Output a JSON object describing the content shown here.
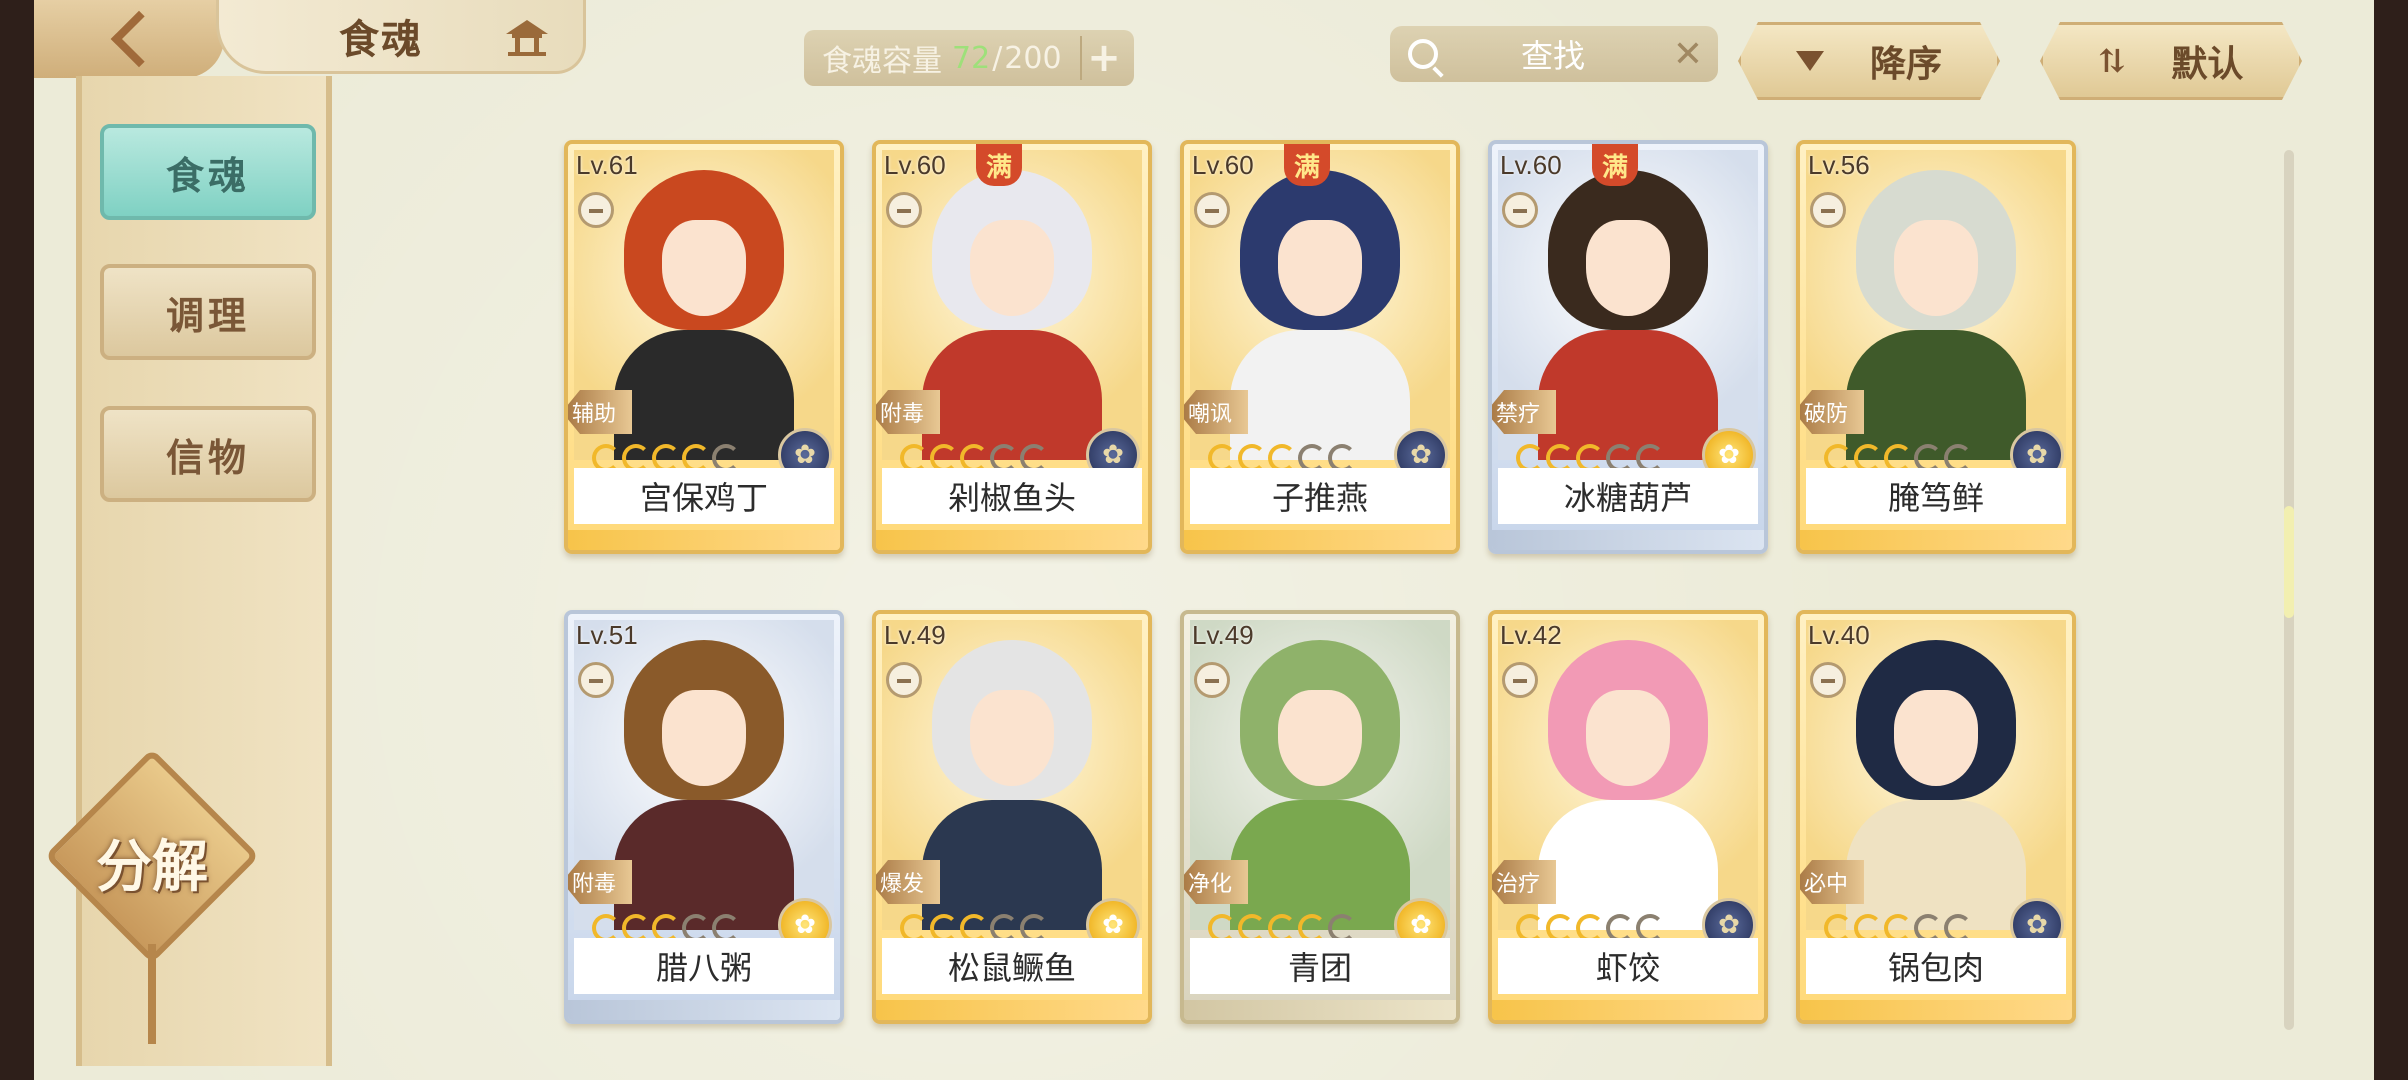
{
  "header": {
    "title": "食魂",
    "capacity_label": "食魂容量",
    "capacity_current": "72",
    "capacity_max": "200",
    "search_placeholder": "查找",
    "sort_label": "降序",
    "default_label": "默认"
  },
  "sidebar": {
    "items": [
      {
        "label": "食魂",
        "active": true
      },
      {
        "label": "调理",
        "active": false
      },
      {
        "label": "信物",
        "active": false
      }
    ],
    "decompose_label": "分解"
  },
  "cards": [
    {
      "level": "Lv.61",
      "name": "宫保鸡丁",
      "role": "辅助",
      "stars_filled": 4,
      "stars_total": 5,
      "maxed": false,
      "element_icon": "night-flower-icon",
      "frame": "gold"
    },
    {
      "level": "Lv.60",
      "name": "剁椒鱼头",
      "role": "附毒",
      "stars_filled": 3,
      "stars_total": 5,
      "maxed": true,
      "maxed_label": "满",
      "element_icon": "night-flower-icon",
      "frame": "gold"
    },
    {
      "level": "Lv.60",
      "name": "子推燕",
      "role": "嘲讽",
      "stars_filled": 3,
      "stars_total": 5,
      "maxed": true,
      "maxed_label": "满",
      "element_icon": "night-flower-icon",
      "frame": "gold"
    },
    {
      "level": "Lv.60",
      "name": "冰糖葫芦",
      "role": "禁疗",
      "stars_filled": 3,
      "stars_total": 5,
      "maxed": true,
      "maxed_label": "满",
      "element_icon": "sun-flower-icon",
      "frame": "blue"
    },
    {
      "level": "Lv.56",
      "name": "腌笃鲜",
      "role": "破防",
      "stars_filled": 3,
      "stars_total": 5,
      "maxed": false,
      "element_icon": "night-flower-icon",
      "frame": "gold"
    },
    {
      "level": "Lv.51",
      "name": "腊八粥",
      "role": "附毒",
      "stars_filled": 3,
      "stars_total": 5,
      "maxed": false,
      "element_icon": "sun-flower-icon",
      "frame": "blue"
    },
    {
      "level": "Lv.49",
      "name": "松鼠鳜鱼",
      "role": "爆发",
      "stars_filled": 3,
      "stars_total": 5,
      "maxed": false,
      "element_icon": "sun-flower-icon",
      "frame": "gold"
    },
    {
      "level": "Lv.49",
      "name": "青团",
      "role": "净化",
      "stars_filled": 4,
      "stars_total": 5,
      "maxed": false,
      "element_icon": "sun-flower-icon",
      "frame": "green"
    },
    {
      "level": "Lv.42",
      "name": "虾饺",
      "role": "治疗",
      "stars_filled": 3,
      "stars_total": 5,
      "maxed": false,
      "element_icon": "night-flower-icon",
      "frame": "gold"
    },
    {
      "level": "Lv.40",
      "name": "锅包肉",
      "role": "必中",
      "stars_filled": 3,
      "stars_total": 5,
      "maxed": false,
      "element_icon": "night-flower-icon",
      "frame": "gold"
    }
  ],
  "colors": {
    "accent_teal": "#7fd1c3",
    "gold": "#f1b82a",
    "capacity_current": "#9ee07a"
  }
}
